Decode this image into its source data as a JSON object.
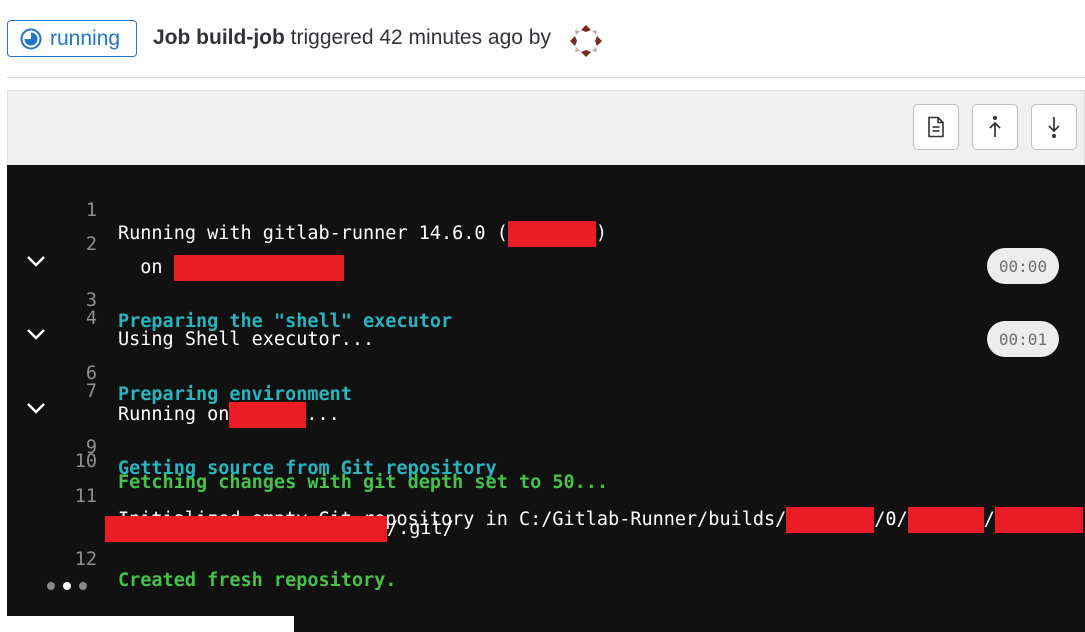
{
  "header": {
    "status_label": "running",
    "job_prefix": "Job build-job",
    "triggered_text": " triggered 42 minutes ago by"
  },
  "toolbar": {
    "buttons": [
      "raw-log",
      "scroll-to-top",
      "scroll-to-bottom"
    ]
  },
  "log": {
    "lines": [
      {
        "num": "1",
        "before": "Running with gitlab-runner 14.6.0 (",
        "after": ")"
      },
      {
        "num": "2",
        "before": "  on "
      },
      {
        "num": "3",
        "text": "Preparing the \"shell\" executor",
        "duration": "00:00"
      },
      {
        "num": "4",
        "text": "Using Shell executor..."
      },
      {
        "num": "6",
        "text": "Preparing environment",
        "duration": "00:01"
      },
      {
        "num": "7",
        "before": "Running on",
        "after": "..."
      },
      {
        "num": "9",
        "text": "Getting source from Git repository"
      },
      {
        "num": "10",
        "text": "Fetching changes with git depth set to 50..."
      },
      {
        "num": "11",
        "text_a": "Initialized empty Git repository in C:/Gitlab-Runner/builds/",
        "text_b": "/0/",
        "text_c": "/",
        "text_d": "/.git/"
      },
      {
        "num": "12",
        "text": "Created fresh repository."
      }
    ]
  },
  "colors": {
    "section_header": "#28b5bf",
    "success": "#46c24a",
    "redaction": "#ec1c24",
    "status_blue": "#1f75cb"
  }
}
